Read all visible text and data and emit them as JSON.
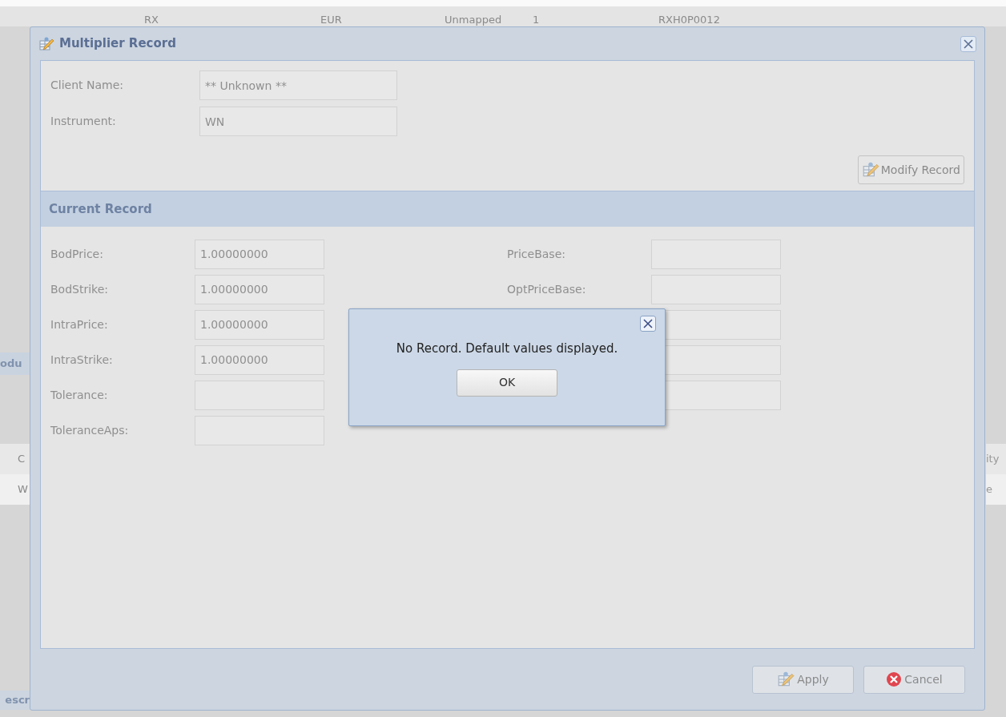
{
  "background": {
    "top_row": [
      "RX",
      "EUR",
      "Unmapped",
      "1",
      "RXH0P0012"
    ],
    "left_fragments": [
      "odu",
      "C",
      "W"
    ],
    "right_fragments": [
      "ity",
      "e"
    ],
    "bottom_fragment": "escr"
  },
  "dialog": {
    "title": "Multiplier Record",
    "header_fields": [
      {
        "label": "Client Name:",
        "value": "** Unknown **"
      },
      {
        "label": "Instrument:",
        "value": "WN"
      }
    ],
    "modify_button": "Modify Record",
    "section_title": "Current Record",
    "fields_left": [
      {
        "label": "BodPrice:",
        "value": "1.00000000"
      },
      {
        "label": "BodStrike:",
        "value": "1.00000000"
      },
      {
        "label": "IntraPrice:",
        "value": "1.00000000"
      },
      {
        "label": "IntraStrike:",
        "value": "1.00000000"
      },
      {
        "label": "Tolerance:"
      },
      {
        "label": "ToleranceAps:"
      }
    ],
    "fields_right": [
      {
        "kind": "labeled_input",
        "label": "PriceBase:"
      },
      {
        "kind": "labeled_input",
        "label": "OptPriceBase:"
      },
      {
        "kind": "input"
      },
      {
        "kind": "input"
      },
      {
        "kind": "input"
      }
    ],
    "buttons": [
      {
        "label": "Apply",
        "kind": "apply"
      },
      {
        "label": "Cancel",
        "kind": "cancel"
      }
    ]
  },
  "alert": {
    "message": "No Record. Default values displayed.",
    "button": "OK"
  }
}
